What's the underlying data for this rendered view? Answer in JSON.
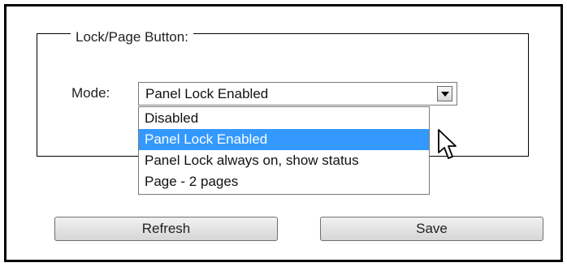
{
  "group": {
    "legend": "Lock/Page Button:"
  },
  "mode": {
    "label": "Mode:",
    "selected_value": "Panel Lock Enabled",
    "options": [
      "Disabled",
      "Panel Lock Enabled",
      "Panel Lock always on, show status",
      "Page - 2 pages"
    ],
    "highlighted_index": 1
  },
  "buttons": {
    "refresh_label": "Refresh",
    "save_label": "Save"
  },
  "colors": {
    "highlight": "#3399ff",
    "border": "#000000"
  },
  "icons": {
    "dropdown_arrow": "chevron-down-icon",
    "cursor": "mouse-pointer-icon"
  }
}
